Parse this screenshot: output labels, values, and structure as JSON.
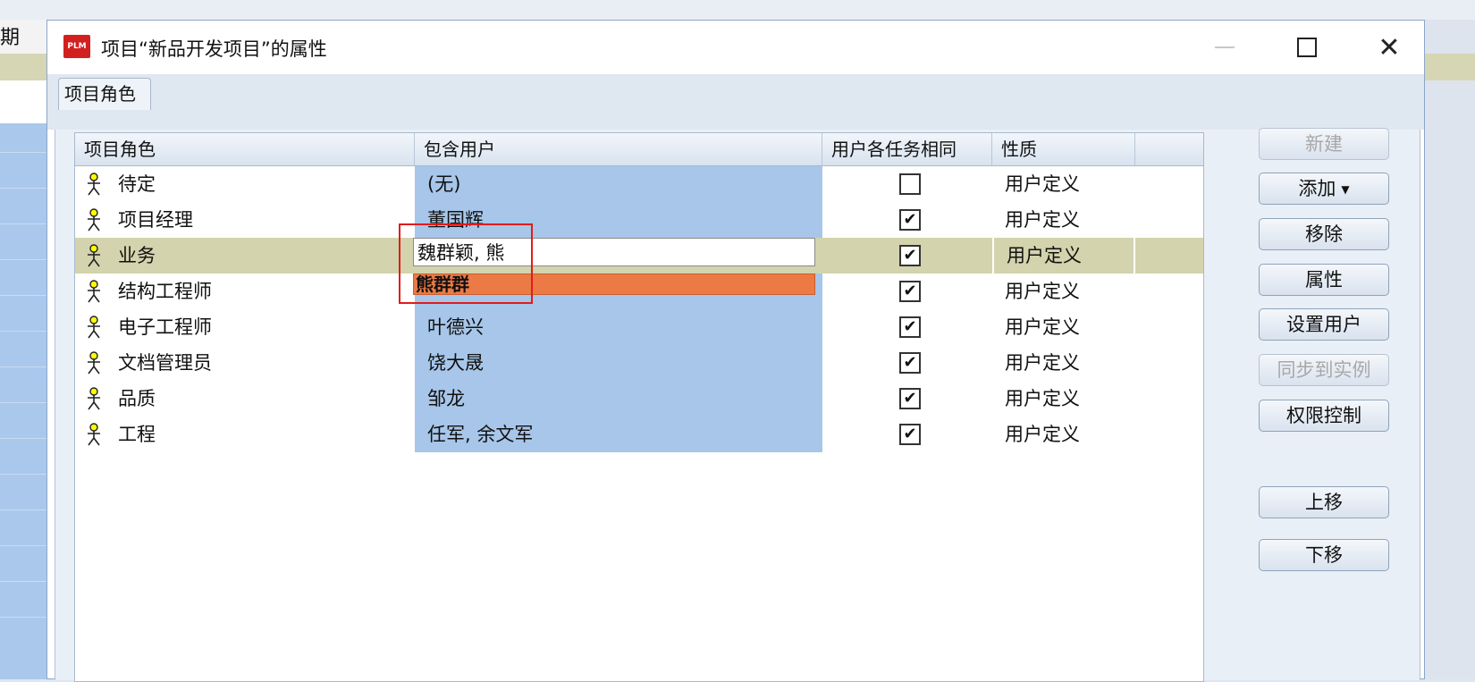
{
  "background": {
    "left_column_label": "期"
  },
  "dialog": {
    "icon_text": "PLM",
    "title": "项目“新品开发项目”的属性"
  },
  "tabs": [
    {
      "label": "项目角色",
      "active": true
    }
  ],
  "grid": {
    "columns": [
      "项目角色",
      "包含用户",
      "用户各任务相同",
      "性质"
    ],
    "rows": [
      {
        "role": "待定",
        "users": "(无)",
        "same_checked": false,
        "nature": "用户定义"
      },
      {
        "role": "项目经理",
        "users": "董国辉",
        "same_checked": true,
        "nature": "用户定义"
      },
      {
        "role": "业务",
        "users": "",
        "same_checked": true,
        "nature": "用户定义",
        "selected": true
      },
      {
        "role": "结构工程师",
        "users": "",
        "same_checked": true,
        "nature": "用户定义"
      },
      {
        "role": "电子工程师",
        "users": "叶德兴",
        "same_checked": true,
        "nature": "用户定义"
      },
      {
        "role": "文档管理员",
        "users": "饶大晟",
        "same_checked": true,
        "nature": "用户定义"
      },
      {
        "role": "品质",
        "users": "邹龙",
        "same_checked": true,
        "nature": "用户定义"
      },
      {
        "role": "工程",
        "users": "任军, 余文军",
        "same_checked": true,
        "nature": "用户定义"
      }
    ]
  },
  "editor": {
    "value": "魏群颖, 熊",
    "suggestion": "熊群群"
  },
  "buttons": {
    "new": "新建",
    "add": "添加",
    "remove": "移除",
    "properties": "属性",
    "set_users": "设置用户",
    "sync_instance": "同步到实例",
    "permissions": "权限控制",
    "move_up": "上移",
    "move_down": "下移"
  },
  "colors": {
    "selected_row": "#d3d3ad",
    "users_column": "#a7c6ea",
    "suggestion": "#ec7a44",
    "highlight_box": "#e21b1b"
  }
}
